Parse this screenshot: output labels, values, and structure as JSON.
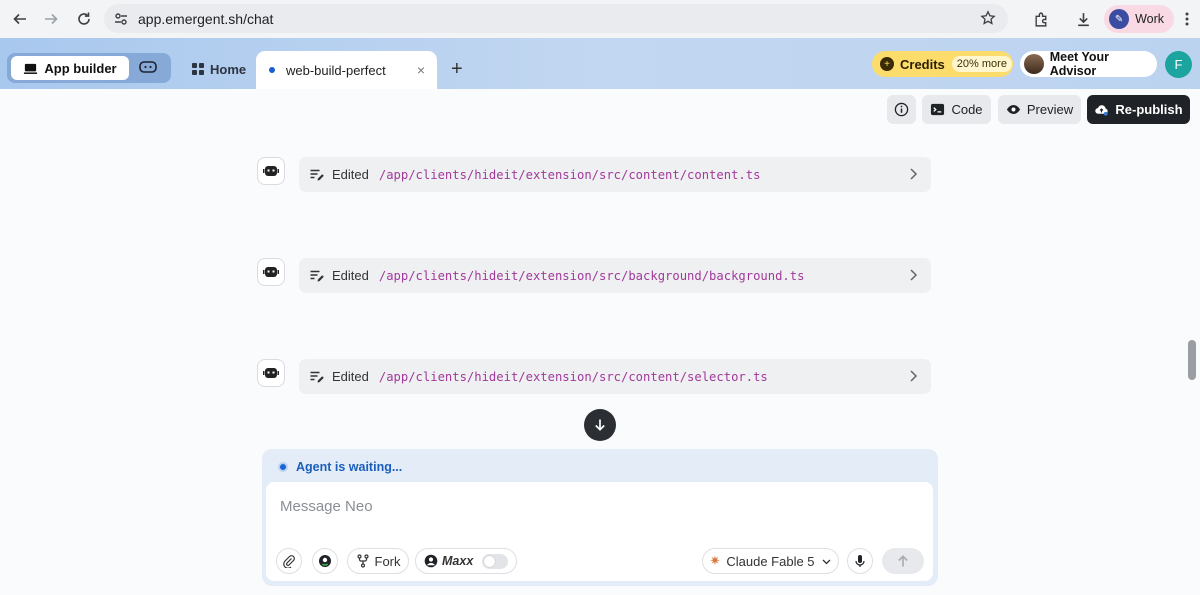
{
  "browser": {
    "url": "app.emergent.sh/chat",
    "profile_label": "Work",
    "icons": [
      "back-arrow-icon",
      "forward-arrow-icon",
      "reload-icon",
      "site-settings-icon",
      "bookmark-star-icon",
      "extensions-icon",
      "download-icon",
      "more-vertical-icon"
    ]
  },
  "appbar": {
    "mode_active_label": "App builder",
    "home_label": "Home",
    "active_tab_label": "web-build-perfect",
    "close_glyph": "×",
    "add_glyph": "+",
    "credits_label": "Credits",
    "credits_more": "20% more",
    "advisor_label": "Meet Your Advisor",
    "user_initial": "F"
  },
  "toolbar": {
    "code_label": "Code",
    "preview_label": "Preview",
    "republish_label": "Re-publish"
  },
  "edits": [
    {
      "label": "Edited",
      "path": "/app/clients/hideit/extension/src/content/content.ts"
    },
    {
      "label": "Edited",
      "path": "/app/clients/hideit/extension/src/background/background.ts"
    },
    {
      "label": "Edited",
      "path": "/app/clients/hideit/extension/src/content/selector.ts"
    }
  ],
  "composer": {
    "status": "Agent is waiting...",
    "placeholder": "Message Neo",
    "fork_label": "Fork",
    "maxx_label": "Maxx",
    "maxx_enabled": false,
    "model_label": "Claude Fable 5"
  },
  "colors": {
    "accent_blue": "#1b66d2",
    "path_magenta": "#a2399b",
    "credits_yellow": "#fcdc6b",
    "republish_dark": "#1f2226"
  }
}
